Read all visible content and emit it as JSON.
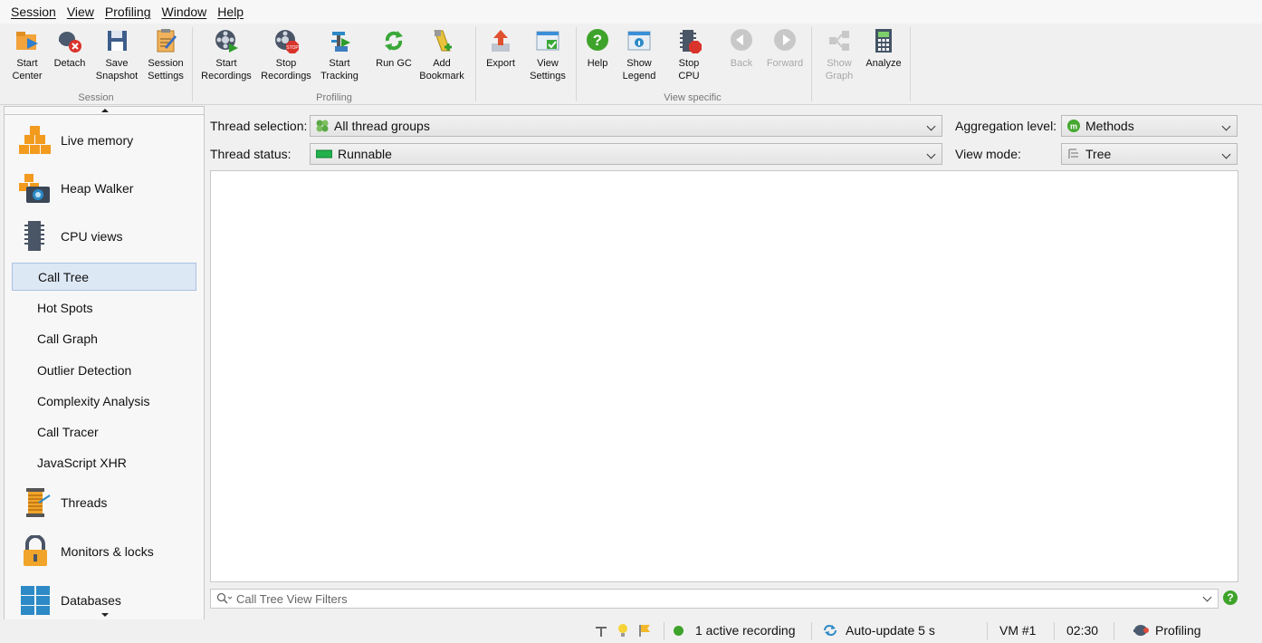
{
  "menu": [
    "Session",
    "View",
    "Profiling",
    "Window",
    "Help"
  ],
  "toolbar": {
    "groups": {
      "session": "Session",
      "profiling": "Profiling",
      "view_specific": "View specific"
    },
    "buttons": {
      "start_center": "Start\nCenter",
      "detach": "Detach",
      "save_snapshot": "Save\nSnapshot",
      "session_settings": "Session\nSettings",
      "start_recordings": "Start\nRecordings",
      "stop_recordings": "Stop\nRecordings",
      "start_tracking": "Start\nTracking",
      "run_gc": "Run GC",
      "add_bookmark": "Add\nBookmark",
      "export": "Export",
      "view_settings": "View\nSettings",
      "help": "Help",
      "show_legend": "Show\nLegend",
      "stop_cpu": "Stop\nCPU",
      "back": "Back",
      "forward": "Forward",
      "show_graph": "Show\nGraph",
      "analyze": "Analyze"
    }
  },
  "sidebar": {
    "sections": {
      "live_memory": "Live memory",
      "heap_walker": "Heap Walker",
      "cpu_views": "CPU views",
      "threads": "Threads",
      "monitors_locks": "Monitors & locks",
      "databases": "Databases"
    },
    "cpu_items": [
      "Call Tree",
      "Hot Spots",
      "Call Graph",
      "Outlier Detection",
      "Complexity Analysis",
      "Call Tracer",
      "JavaScript XHR"
    ],
    "selected_item": "Call Tree"
  },
  "filters": {
    "thread_selection_label": "Thread selection:",
    "thread_selection_value": "All thread groups",
    "thread_status_label": "Thread status:",
    "thread_status_value": "Runnable",
    "aggregation_label": "Aggregation level:",
    "aggregation_value": "Methods",
    "view_mode_label": "View mode:",
    "view_mode_value": "Tree"
  },
  "filter_bar": {
    "placeholder": "Call Tree View Filters"
  },
  "statusbar": {
    "recording": "1 active recording",
    "autoupdate": "Auto-update 5 s",
    "vm": "VM #1",
    "time": "02:30",
    "mode": "Profiling"
  },
  "colors": {
    "accent_selected": "#dde8f5",
    "recording_dot": "#3ea32a",
    "runnable_green": "#22b14c",
    "methods_badge": "#44a82f"
  },
  "icons": [
    "start-center-icon",
    "detach-icon",
    "save-icon",
    "settings-icon",
    "recordings-icon",
    "stop-recordings-icon",
    "tracking-icon",
    "gc-icon",
    "bookmark-icon",
    "export-icon",
    "view-settings-icon",
    "help-icon",
    "legend-icon",
    "stop-cpu-icon",
    "back-icon",
    "forward-icon",
    "graph-icon",
    "calculator-icon"
  ]
}
